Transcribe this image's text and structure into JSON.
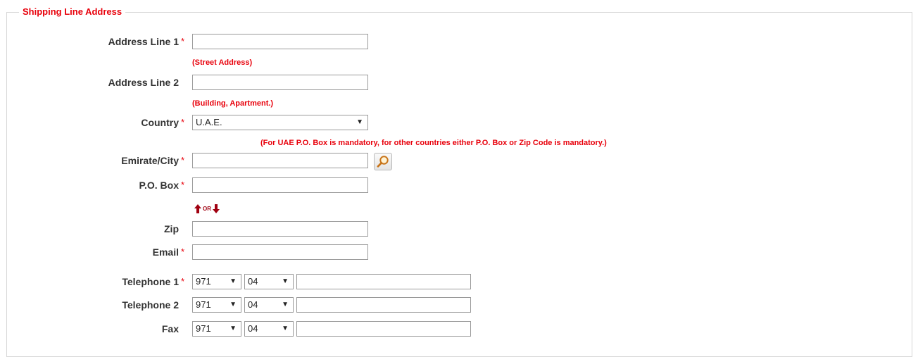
{
  "section": {
    "legend": "Shipping Line Address",
    "required_mark": "*"
  },
  "fields": {
    "address1": {
      "label": "Address Line 1",
      "value": "",
      "hint": "(Street Address)"
    },
    "address2": {
      "label": "Address Line 2",
      "value": "",
      "hint": "(Building, Apartment.)"
    },
    "country": {
      "label": "Country",
      "selected": "U.A.E.",
      "hint": "(For UAE P.O. Box is mandatory, for other countries either P.O. Box or Zip Code is mandatory.)"
    },
    "city": {
      "label": "Emirate/City",
      "value": "",
      "lookup_icon": "magnifier-icon"
    },
    "pobox": {
      "label": "P.O. Box",
      "value": ""
    },
    "or_text": "OR",
    "zip": {
      "label": "Zip",
      "value": ""
    },
    "email": {
      "label": "Email",
      "value": ""
    },
    "telephone1": {
      "label": "Telephone 1",
      "country_code": "971",
      "area_code": "04",
      "number": ""
    },
    "telephone2": {
      "label": "Telephone 2",
      "country_code": "971",
      "area_code": "04",
      "number": ""
    },
    "fax": {
      "label": "Fax",
      "country_code": "971",
      "area_code": "04",
      "number": ""
    }
  },
  "colors": {
    "accent_red": "#e8000b",
    "arrow_red": "#a00010",
    "border": "#d6d6d6",
    "input_border": "#9a9a9a"
  }
}
